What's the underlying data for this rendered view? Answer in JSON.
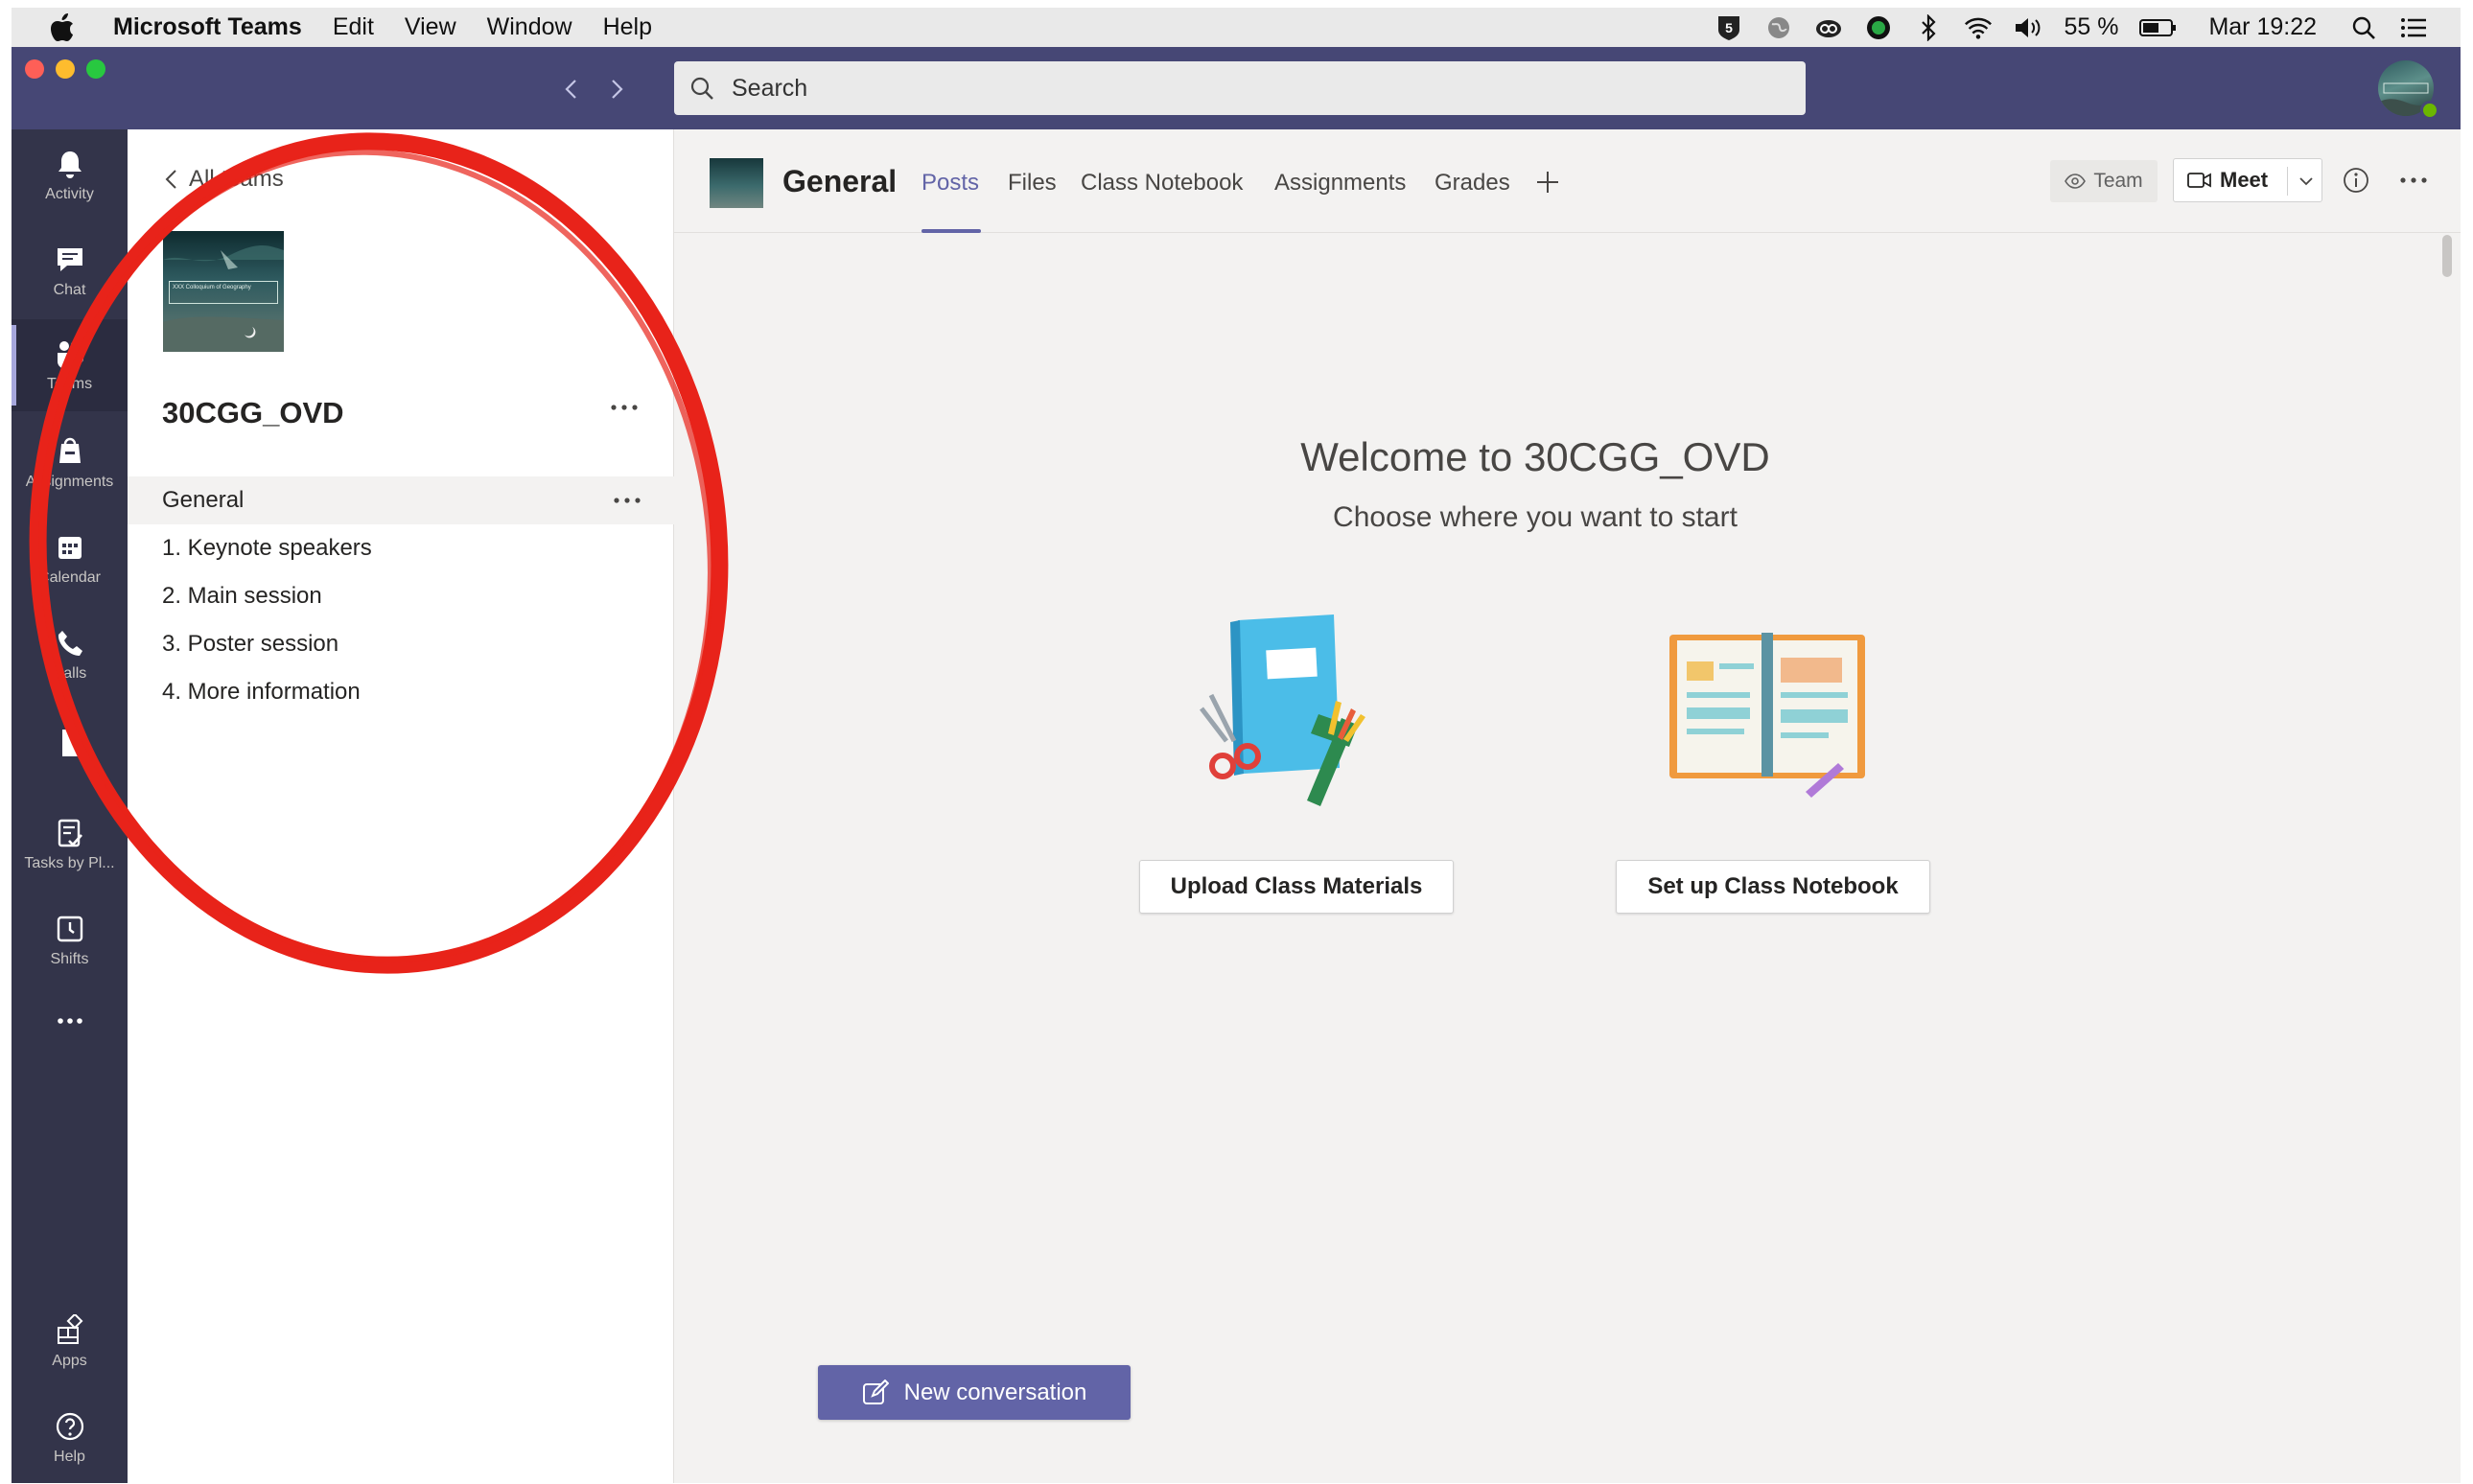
{
  "menubar": {
    "app_name": "Microsoft Teams",
    "items": [
      "Edit",
      "View",
      "Window",
      "Help"
    ],
    "battery": "55 %",
    "clock": "Mar 19:22"
  },
  "titlebar": {
    "search_placeholder": "Search"
  },
  "app_rail": {
    "items": [
      {
        "label": "Activity",
        "icon": "bell-icon"
      },
      {
        "label": "Chat",
        "icon": "chat-icon"
      },
      {
        "label": "Teams",
        "icon": "teams-icon",
        "active": true
      },
      {
        "label": "Assignments",
        "icon": "assignments-icon"
      },
      {
        "label": "Calendar",
        "icon": "calendar-icon"
      },
      {
        "label": "Calls",
        "icon": "phone-icon"
      },
      {
        "label": "",
        "icon": "files-icon"
      },
      {
        "label": "Tasks by Pl...",
        "icon": "tasks-icon"
      },
      {
        "label": "Shifts",
        "icon": "shifts-icon"
      },
      {
        "label": "",
        "icon": "more-apps-icon"
      }
    ],
    "bottom": [
      {
        "label": "Apps",
        "icon": "apps-icon"
      },
      {
        "label": "Help",
        "icon": "help-icon"
      }
    ]
  },
  "team_panel": {
    "back_label": "All teams",
    "team_name": "30CGG_OVD",
    "team_image_caption": "XXX Colloquium of Geography",
    "channels": [
      {
        "label": "General",
        "active": true
      },
      {
        "label": "1. Keynote speakers"
      },
      {
        "label": "2. Main session"
      },
      {
        "label": "3. Poster session"
      },
      {
        "label": "4. More information"
      }
    ]
  },
  "channel_header": {
    "title": "General",
    "tabs": [
      "Posts",
      "Files",
      "Class Notebook",
      "Assignments",
      "Grades"
    ],
    "active_tab": "Posts",
    "team_button": "Team",
    "meet_button": "Meet"
  },
  "welcome": {
    "title": "Welcome to 30CGG_OVD",
    "subtitle": "Choose where you want to start",
    "upload_button": "Upload Class Materials",
    "notebook_button": "Set up Class Notebook"
  },
  "compose": {
    "new_conversation": "New conversation"
  },
  "colors": {
    "brand": "#6264a7",
    "titlebar": "#464775",
    "rail": "#33344a",
    "annotation": "#e8231a"
  }
}
